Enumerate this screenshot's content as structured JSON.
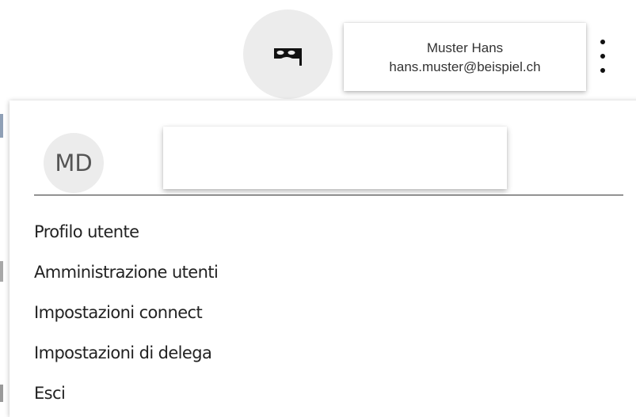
{
  "header": {
    "impersonate_icon": "mask-icon",
    "user": {
      "name": "Muster Hans",
      "email": "hans.muster@beispiel.ch"
    },
    "more_icon": "more-vertical-icon"
  },
  "menu": {
    "avatar_initials": "MD",
    "name_field_value": "",
    "items": [
      {
        "label": "Profilo utente"
      },
      {
        "label": "Amministrazione utenti"
      },
      {
        "label": "Impostazioni connect"
      },
      {
        "label": "Impostazioni di delega"
      },
      {
        "label": "Esci"
      }
    ]
  },
  "colors": {
    "avatar_bg": "#ececec",
    "text": "#222222"
  }
}
